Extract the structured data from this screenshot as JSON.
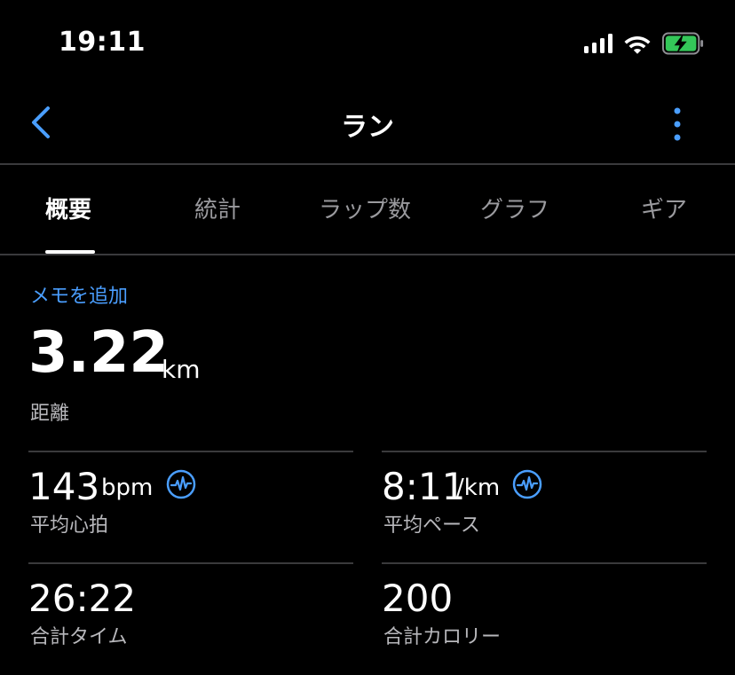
{
  "status_bar": {
    "time": "19:11"
  },
  "nav": {
    "title": "ラン"
  },
  "tabs": [
    {
      "label": "概要",
      "active": true
    },
    {
      "label": "統計",
      "active": false
    },
    {
      "label": "ラップ数",
      "active": false
    },
    {
      "label": "グラフ",
      "active": false
    },
    {
      "label": "ギア",
      "active": false
    }
  ],
  "memo": {
    "add_label": "メモを追加"
  },
  "distance": {
    "value": "3.22",
    "unit": "km",
    "label": "距離"
  },
  "stats": {
    "avg_hr": {
      "value": "143",
      "unit": "bpm",
      "label": "平均心拍"
    },
    "avg_pace": {
      "value": "8:11",
      "unit": "/km",
      "label": "平均ペース"
    },
    "total_time": {
      "value": "26:22",
      "label": "合計タイム"
    },
    "calories": {
      "value": "200",
      "label": "合計カロリー"
    }
  },
  "colors": {
    "background": "#000000",
    "accent": "#4a9eff",
    "divider": "#3a3a3c",
    "battery_green": "#34c759"
  },
  "icons": {
    "back": "chevron-left-icon",
    "more": "more-vertical-icon",
    "heart_rate": "heart-rate-icon",
    "signal": "cellular-signal-icon",
    "wifi": "wifi-icon",
    "battery": "battery-charging-icon"
  }
}
